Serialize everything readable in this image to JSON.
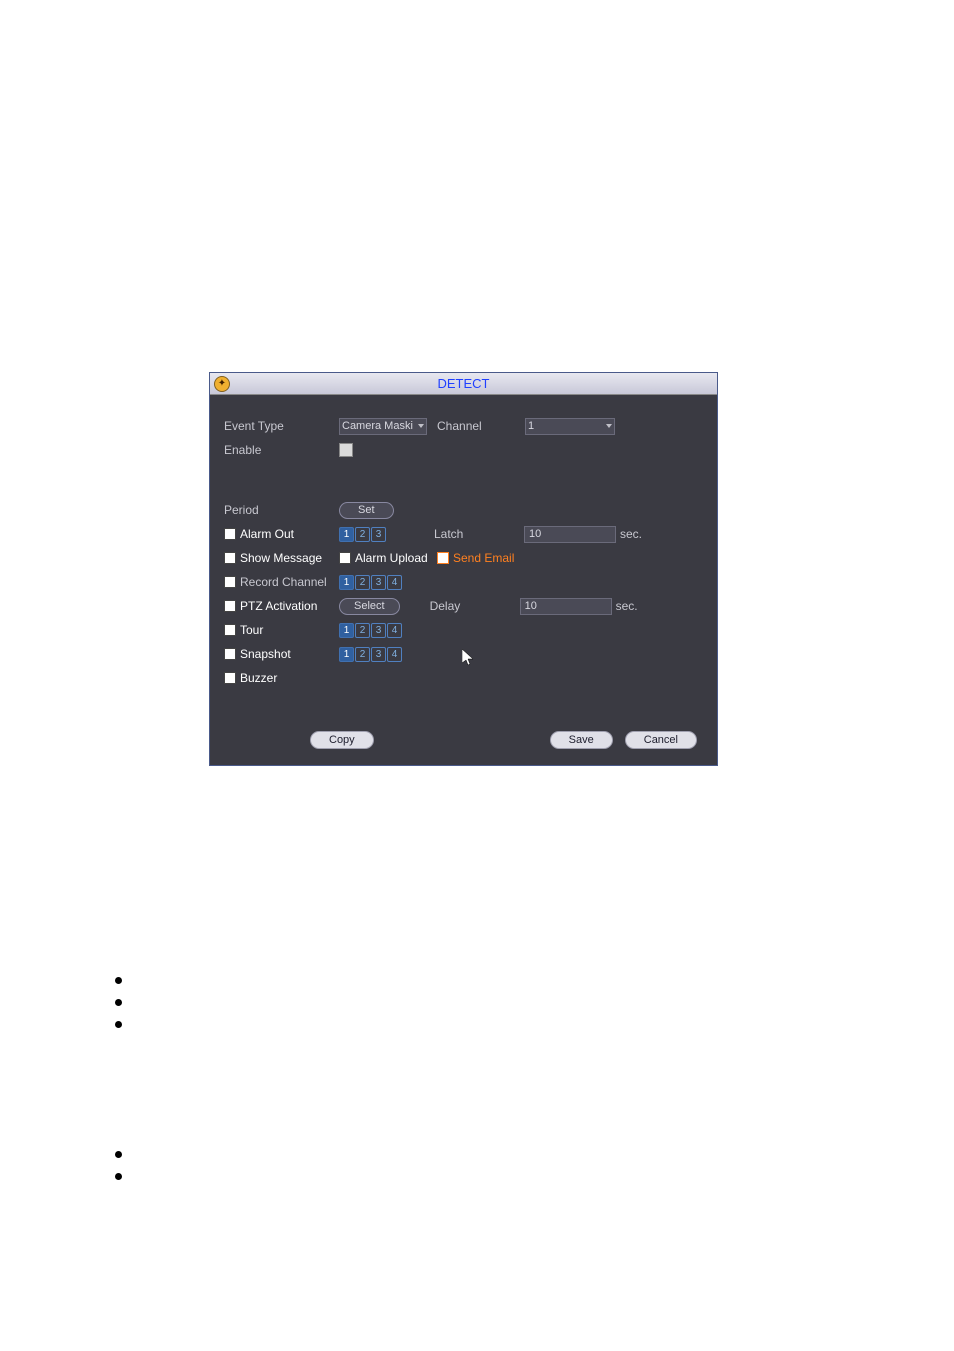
{
  "dialog": {
    "title": "DETECT",
    "fields": {
      "event_type_label": "Event Type",
      "event_type_value": "Camera Maski",
      "channel_label": "Channel",
      "channel_value": "1",
      "enable_label": "Enable",
      "period_label": "Period",
      "set_button": "Set",
      "alarm_out_label": "Alarm Out",
      "alarm_out_channels": [
        "1",
        "2",
        "3"
      ],
      "latch_label": "Latch",
      "latch_value": "10",
      "latch_unit": "sec.",
      "show_message_label": "Show Message",
      "alarm_upload_label": "Alarm Upload",
      "send_email_label": "Send Email",
      "record_channel_label": "Record Channel",
      "record_channels": [
        "1",
        "2",
        "3",
        "4"
      ],
      "ptz_activation_label": "PTZ Activation",
      "select_button": "Select",
      "delay_label": "Delay",
      "delay_value": "10",
      "delay_unit": "sec.",
      "tour_label": "Tour",
      "tour_channels": [
        "1",
        "2",
        "3",
        "4"
      ],
      "snapshot_label": "Snapshot",
      "snapshot_channels": [
        "1",
        "2",
        "3",
        "4"
      ],
      "buzzer_label": "Buzzer"
    },
    "buttons": {
      "copy": "Copy",
      "save": "Save",
      "cancel": "Cancel"
    }
  }
}
